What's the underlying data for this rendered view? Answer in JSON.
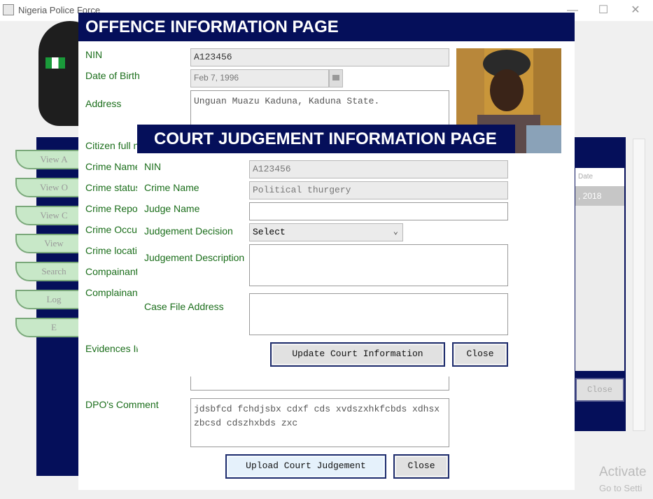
{
  "window": {
    "title": "Nigeria Police Force",
    "minimize": "—",
    "maximize": "☐",
    "close": "✕"
  },
  "background": {
    "nav_buttons": [
      "View A",
      "View O",
      "View C",
      "View",
      "Search",
      "Log",
      "E"
    ],
    "right_header": "Date",
    "right_row": ", 2018",
    "right_close": "Close",
    "activate_title": "Activate",
    "activate_sub": "Go to Setti"
  },
  "offence": {
    "title": "OFFENCE INFORMATION PAGE",
    "labels": {
      "nin": "NIN",
      "dob": "Date of Birth",
      "address": "Address",
      "citizen_name": "Citizen full na",
      "crime_name": "Crime Name",
      "crime_status": "Crime status",
      "crime_report": "Crime Repor",
      "crime_occur": "Crime Occur",
      "crime_location": "Crime locatio",
      "complainant": "Compainant",
      "complainant2": "Complainant",
      "evidences": "Evidences Ir",
      "dpo_comment": "DPO's Comment"
    },
    "nin_value": "A123456",
    "dob_value": "Feb 7, 1996",
    "address_value": "Unguan Muazu Kaduna, Kaduna State.",
    "dpo_comment_value": "jdsbfcd fchdjsbx cdxf cds xvdszxhkfcbds xdhsx zbcsd cdszhxbds zxc",
    "upload_button": "Upload Court Judgement",
    "close_button": "Close"
  },
  "court": {
    "title": "COURT JUDGEMENT INFORMATION PAGE",
    "labels": {
      "nin": "NIN",
      "crime_name": "Crime Name",
      "judge_name": "Judge Name",
      "judgement_decision": "Judgement Decision",
      "judgement_description": "Judgement Description",
      "case_file_address": "Case File Address"
    },
    "nin_value": "A123456",
    "crime_name_value": "Political thurgery",
    "judge_name_value": "",
    "decision_value": "Select",
    "update_button": "Update Court Information",
    "close_button": "Close"
  },
  "colors": {
    "banner": "#050f5a",
    "label": "#1b6e1b",
    "button_border": "#1f2d6e"
  },
  "icons": {
    "calendar": "calendar-icon",
    "dropdown": "chevron-down-icon",
    "app": "java-app-icon"
  }
}
